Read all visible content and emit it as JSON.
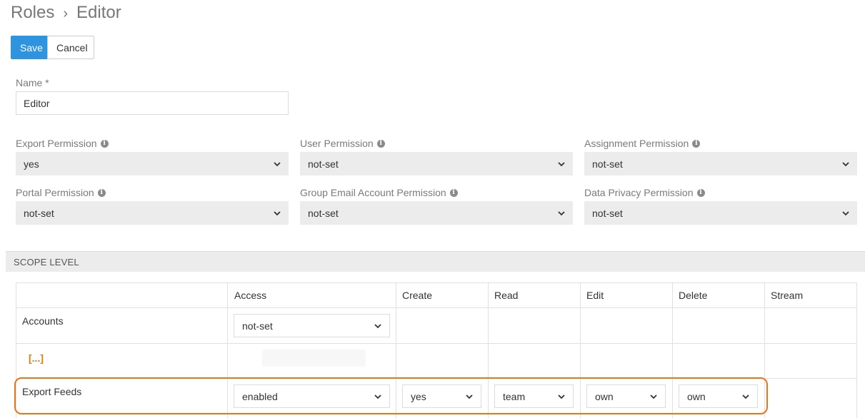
{
  "breadcrumb": {
    "parent": "Roles",
    "separator": "›",
    "current": "Editor"
  },
  "toolbar": {
    "save_label": "Save",
    "cancel_label": "Cancel"
  },
  "name_field": {
    "label": "Name *",
    "value": "Editor"
  },
  "permissions": [
    {
      "label": "Export Permission",
      "value": "yes"
    },
    {
      "label": "User Permission",
      "value": "not-set"
    },
    {
      "label": "Assignment Permission",
      "value": "not-set"
    },
    {
      "label": "Portal Permission",
      "value": "not-set"
    },
    {
      "label": "Group Email Account Permission",
      "value": "not-set"
    },
    {
      "label": "Data Privacy Permission",
      "value": "not-set"
    }
  ],
  "scope": {
    "section_title": "SCOPE LEVEL",
    "columns": [
      "Access",
      "Create",
      "Read",
      "Edit",
      "Delete",
      "Stream"
    ],
    "rows": [
      {
        "label": "Accounts",
        "access": "not-set"
      },
      {
        "label": "[...]"
      },
      {
        "label": "Export Feeds",
        "access": "enabled",
        "create": "yes",
        "read": "team",
        "edit": "own",
        "delete": "own"
      }
    ]
  },
  "colors": {
    "primary": "#2e94e0",
    "highlight": "#e8741c",
    "ellipsis": "#e07a10"
  },
  "icons": {
    "info": "info-icon",
    "dropdown": "chevron-down-icon"
  }
}
